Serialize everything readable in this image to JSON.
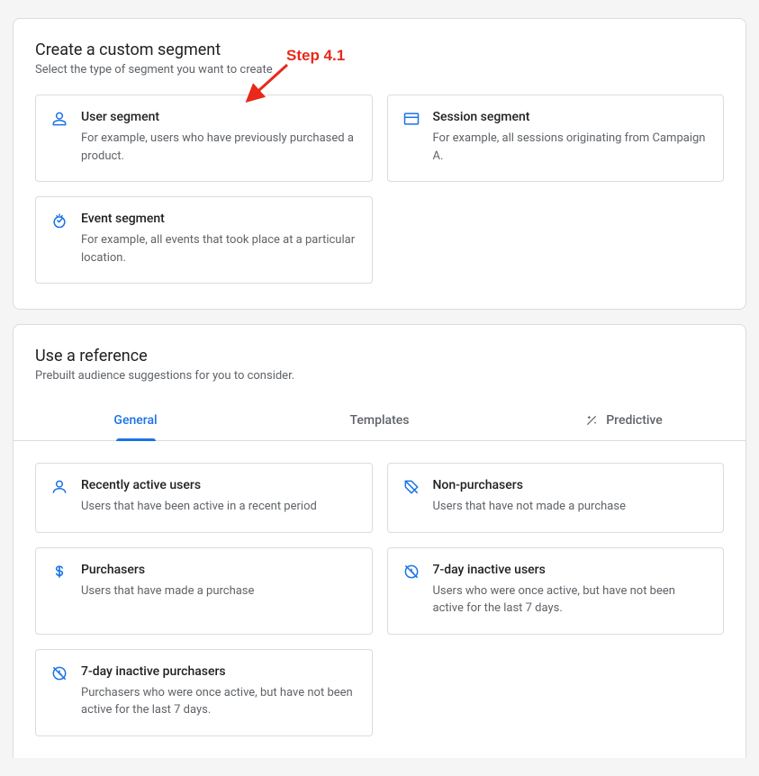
{
  "custom": {
    "title": "Create a custom segment",
    "subtitle": "Select the type of segment you want to create",
    "cards": [
      {
        "title": "User segment",
        "desc": "For example, users who have previously purchased a product."
      },
      {
        "title": "Session segment",
        "desc": "For example, all sessions originating from Campaign A."
      },
      {
        "title": "Event segment",
        "desc": "For example, all events that took place at a particular location."
      }
    ]
  },
  "reference": {
    "title": "Use a reference",
    "subtitle": "Prebuilt audience suggestions for you to consider.",
    "tabs": [
      {
        "label": "General"
      },
      {
        "label": "Templates"
      },
      {
        "label": "Predictive"
      }
    ],
    "cards": [
      {
        "title": "Recently active users",
        "desc": "Users that have been active in a recent period"
      },
      {
        "title": "Non-purchasers",
        "desc": "Users that have not made a purchase"
      },
      {
        "title": "Purchasers",
        "desc": "Users that have made a purchase"
      },
      {
        "title": "7-day inactive users",
        "desc": "Users who were once active, but have not been active for the last 7 days."
      },
      {
        "title": "7-day inactive purchasers",
        "desc": "Purchasers who were once active, but have not been active for the last 7 days."
      }
    ]
  },
  "annotation": {
    "label": "Step 4.1"
  }
}
